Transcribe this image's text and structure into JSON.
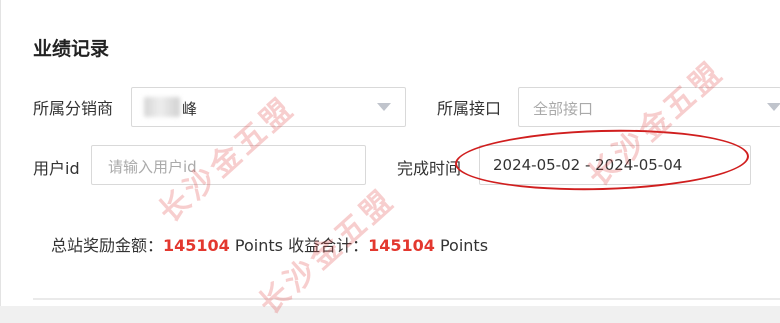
{
  "page": {
    "title": "业绩记录"
  },
  "filters": {
    "distributor_label": "所属分销商",
    "distributor_value": "峰",
    "interface_label": "所属接口",
    "interface_value": "全部接口",
    "user_id_label": "用户id",
    "user_id_placeholder": "请输入用户id",
    "completion_time_label": "完成时间",
    "date_range": "2024-05-02 - 2024-05-04"
  },
  "summary": {
    "bonus_label": "总站奖励金额：",
    "bonus_value": "145104",
    "bonus_unit": "Points",
    "income_label": "收益合计：",
    "income_value": "145104",
    "income_unit": "Points"
  },
  "watermark": {
    "text": "长沙金五盟",
    "color": "#e15050"
  },
  "annotation": {
    "circle_color": "#d01e1e"
  }
}
